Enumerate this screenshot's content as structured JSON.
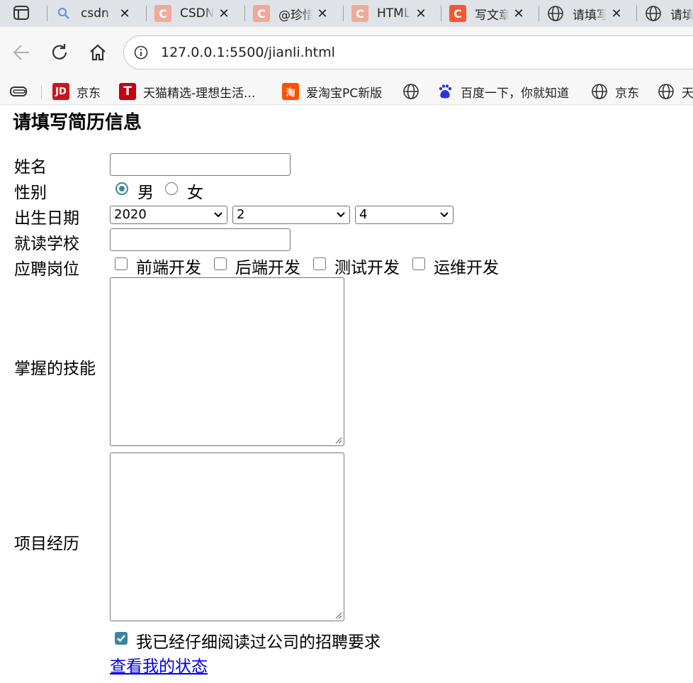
{
  "browser": {
    "tabs": [
      {
        "title": "csdn -",
        "favicon": "search-icon",
        "color": "#5b8def"
      },
      {
        "title": "CSDN",
        "favicon": "csdn-icon",
        "color": "#f0a99a"
      },
      {
        "title": "@珍惜",
        "favicon": "csdn-icon",
        "color": "#f0a99a"
      },
      {
        "title": "HTML",
        "favicon": "csdn-icon",
        "color": "#f0a99a"
      },
      {
        "title": "写文章",
        "favicon": "csdn-icon",
        "color": "#fc5531"
      },
      {
        "title": "请填写",
        "favicon": "globe-icon",
        "color": "#5f6368"
      },
      {
        "title": "请填",
        "favicon": "globe-icon",
        "color": "#5f6368"
      }
    ],
    "url": "127.0.0.1:5500/jianli.html",
    "bookmarks": [
      {
        "label": "京东",
        "icon": "jd-icon",
        "badge": "JD",
        "color": "#c8161d"
      },
      {
        "label": "天猫精选-理想生活...",
        "icon": "tmall-icon",
        "badge": "T",
        "color": "#c40014"
      },
      {
        "label": "爱淘宝PC新版",
        "icon": "taobao-icon",
        "badge": "淘",
        "color": "#ff5000"
      },
      {
        "label": "",
        "icon": "globe-icon",
        "badge": "",
        "color": "#5f6368"
      },
      {
        "label": "百度一下，你就知道",
        "icon": "baidu-icon",
        "badge": "",
        "color": "#2932e1"
      },
      {
        "label": "京东",
        "icon": "globe-icon",
        "badge": "",
        "color": "#5f6368"
      },
      {
        "label": "天",
        "icon": "globe-icon",
        "badge": "",
        "color": "#5f6368"
      }
    ]
  },
  "form": {
    "title": "请填写简历信息",
    "name_label": "姓名",
    "name_value": "",
    "gender_label": "性别",
    "gender_options": [
      "男",
      "女"
    ],
    "gender_selected": "男",
    "birth_label": "出生日期",
    "birth_year": "2020",
    "birth_month": "2",
    "birth_day": "4",
    "school_label": "就读学校",
    "school_value": "",
    "position_label": "应聘岗位",
    "positions": [
      "前端开发",
      "后端开发",
      "测试开发",
      "运维开发"
    ],
    "skills_label": "掌握的技能",
    "skills_value": "",
    "projects_label": "项目经历",
    "projects_value": "",
    "agree_text": "我已经仔细阅读过公司的招聘要求",
    "agree_checked": true,
    "status_link": "查看我的状态"
  },
  "colors": {
    "accent": "#3a86a0",
    "link": "#0000ee"
  }
}
